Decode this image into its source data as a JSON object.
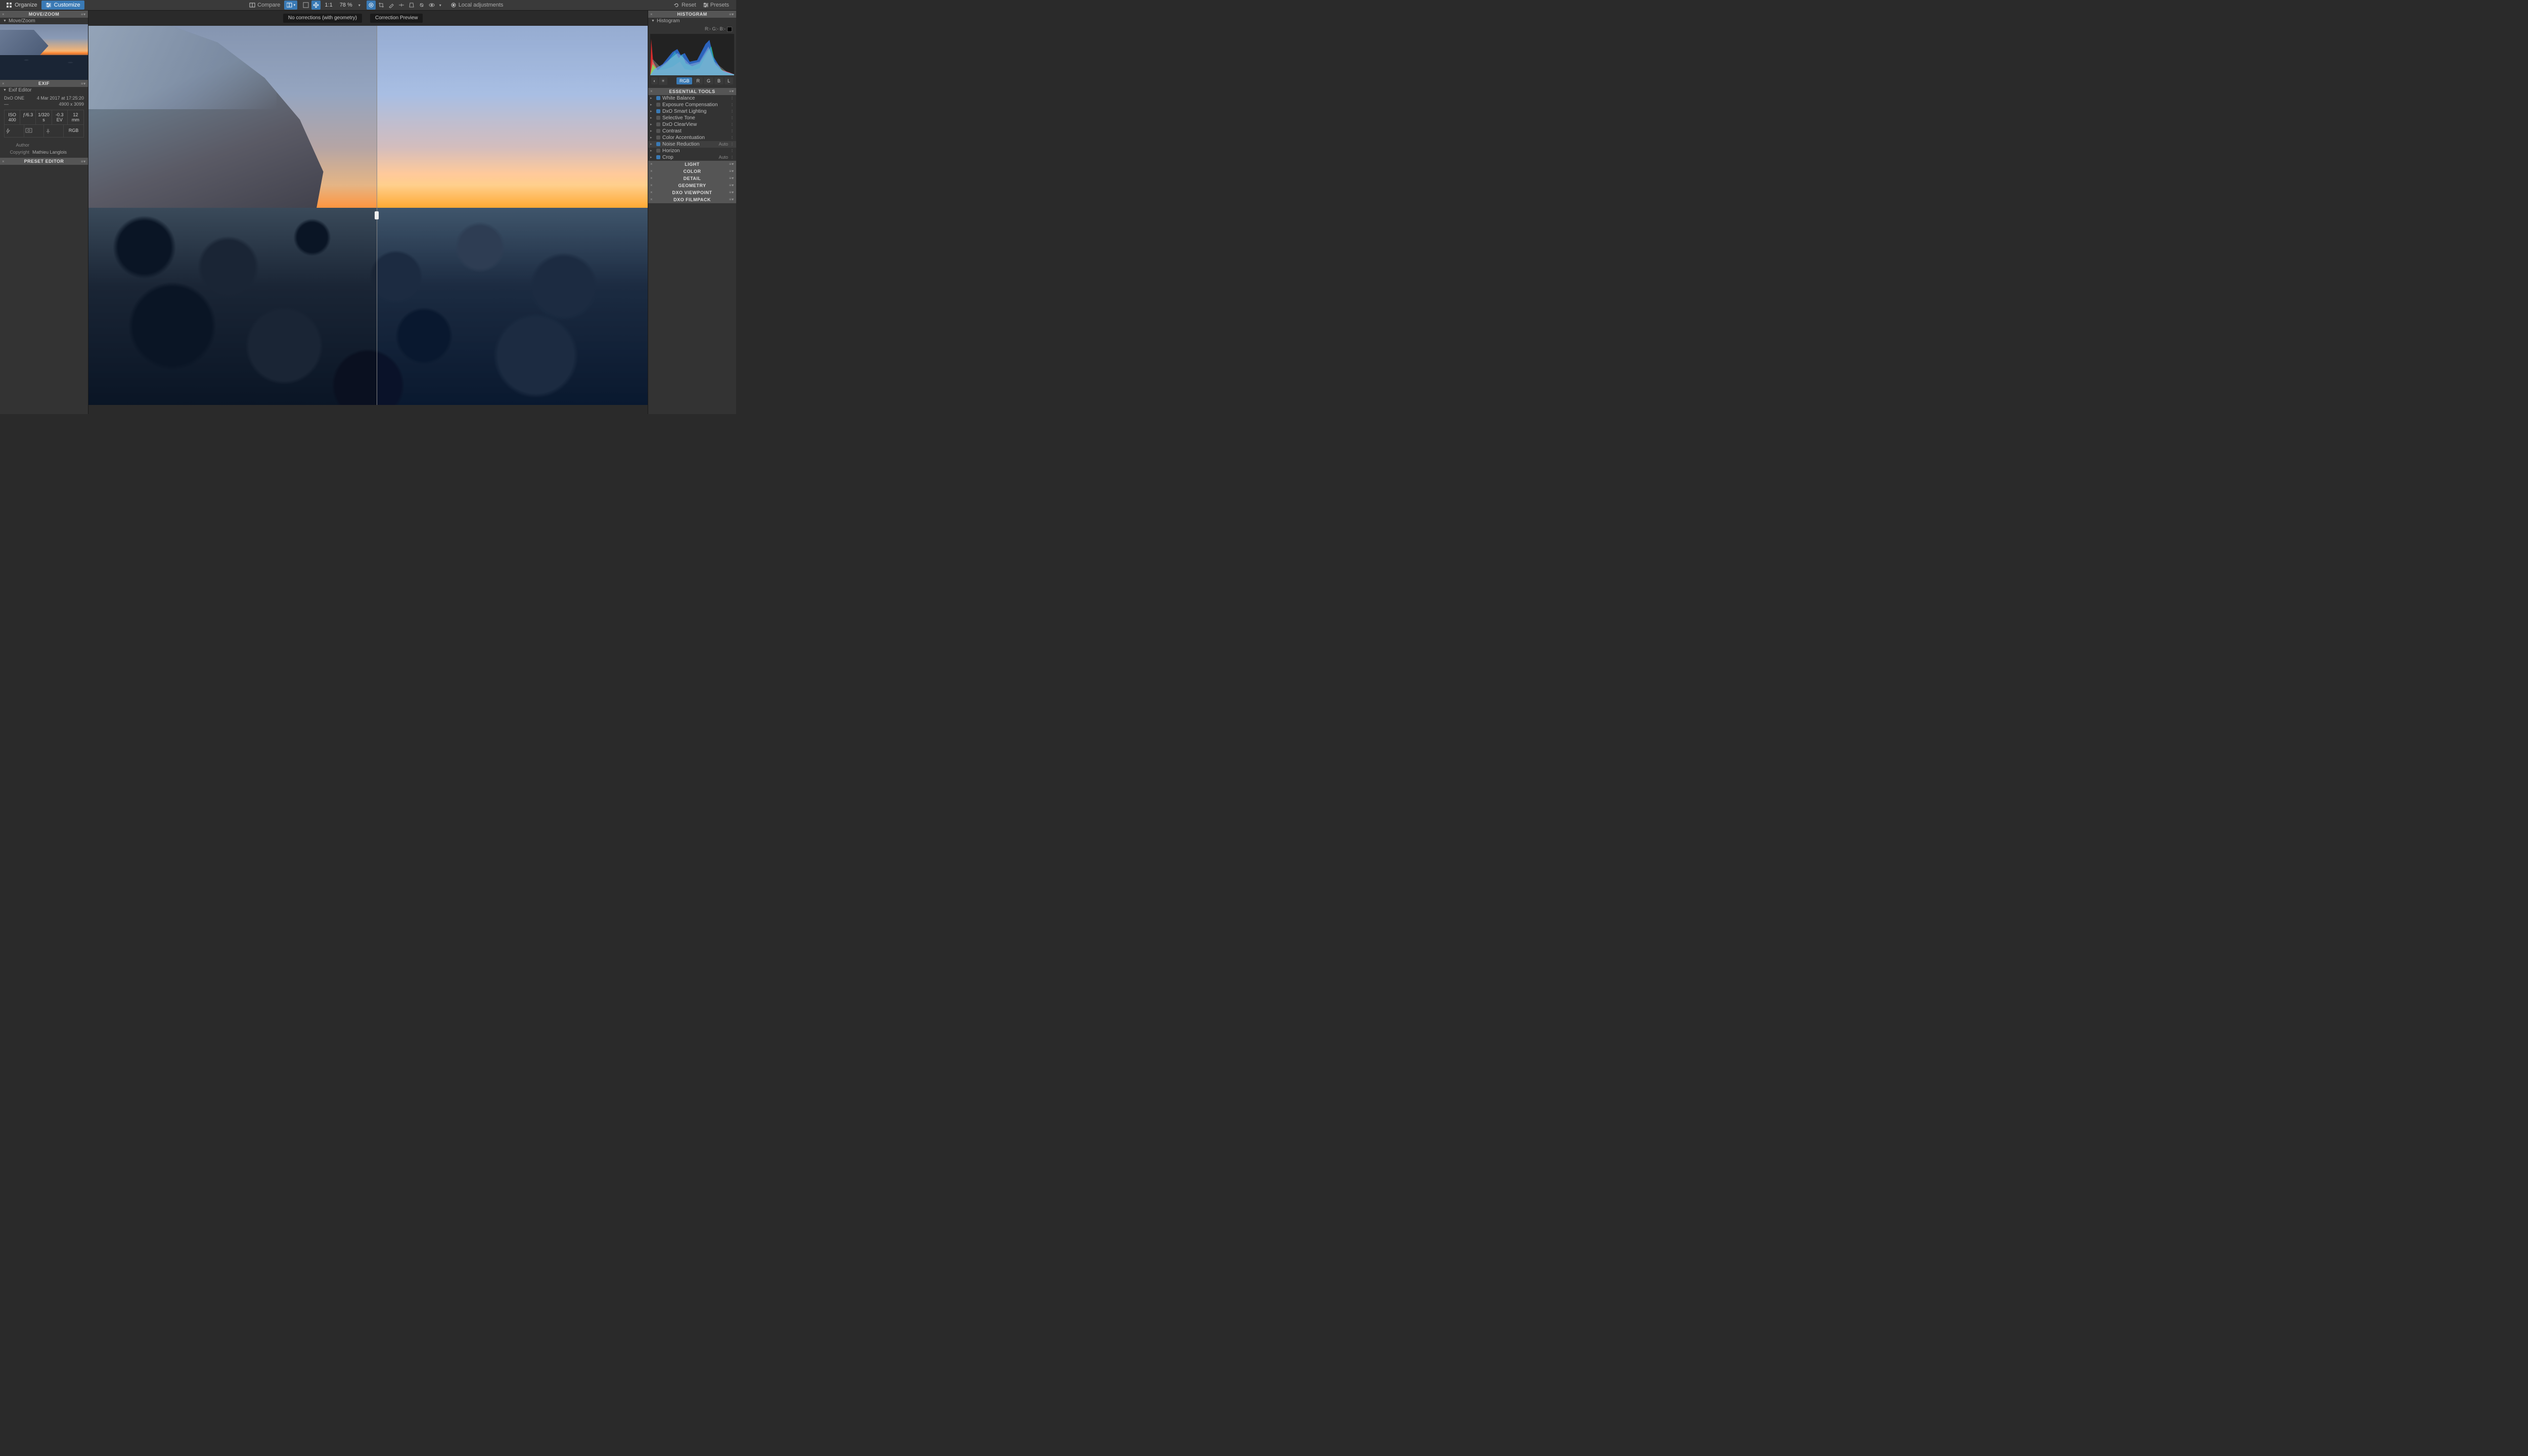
{
  "toolbar": {
    "organize": "Organize",
    "customize": "Customize",
    "compare": "Compare",
    "one_to_one": "1:1",
    "zoom": "78 %",
    "local_adjustments": "Local adjustments",
    "reset": "Reset",
    "presets": "Presets"
  },
  "viewer": {
    "left_label": "No corrections (with geometry)",
    "right_label": "Correction Preview"
  },
  "left": {
    "movezoom": {
      "title": "MOVE/ZOOM",
      "sub": "Move/Zoom"
    },
    "exif": {
      "title": "EXIF",
      "sub": "Exif Editor",
      "camera": "DxO ONE",
      "date": "4 Mar 2017 at 17:25:20",
      "lens": "—",
      "dims": "4900 x 3099",
      "iso": "ISO 400",
      "aperture": "ƒ/6.3",
      "shutter": "1/320 s",
      "ev": "-0.3 EV",
      "focal": "12 mm",
      "rgb": "RGB",
      "author_label": "Author",
      "copyright_label": "Copyright",
      "copyright": "Mathieu Langlois"
    },
    "preset": {
      "title": "PRESET EDITOR"
    }
  },
  "right": {
    "histogram": {
      "title": "HISTOGRAM",
      "sub": "Histogram",
      "readout": "R:- G:- B:-",
      "buttons": {
        "rgb": "RGB",
        "r": "R",
        "g": "G",
        "b": "B",
        "l": "L"
      }
    },
    "essential": {
      "title": "ESSENTIAL TOOLS",
      "items": [
        {
          "name": "White Balance",
          "on": true
        },
        {
          "name": "Exposure Compensation",
          "on": false
        },
        {
          "name": "DxO Smart Lighting",
          "on": true
        },
        {
          "name": "Selective Tone",
          "on": false
        },
        {
          "name": "DxO ClearView",
          "on": false
        },
        {
          "name": "Contrast",
          "on": false
        },
        {
          "name": "Color Accentuation",
          "on": false
        },
        {
          "name": "Noise Reduction",
          "on": true,
          "auto": "Auto",
          "hl": true
        },
        {
          "name": "Horizon",
          "on": false
        },
        {
          "name": "Crop",
          "on": true,
          "auto": "Auto"
        }
      ]
    },
    "sections": [
      "LIGHT",
      "COLOR",
      "DETAIL",
      "GEOMETRY",
      "DXO VIEWPOINT",
      "DXO FILMPACK"
    ]
  }
}
